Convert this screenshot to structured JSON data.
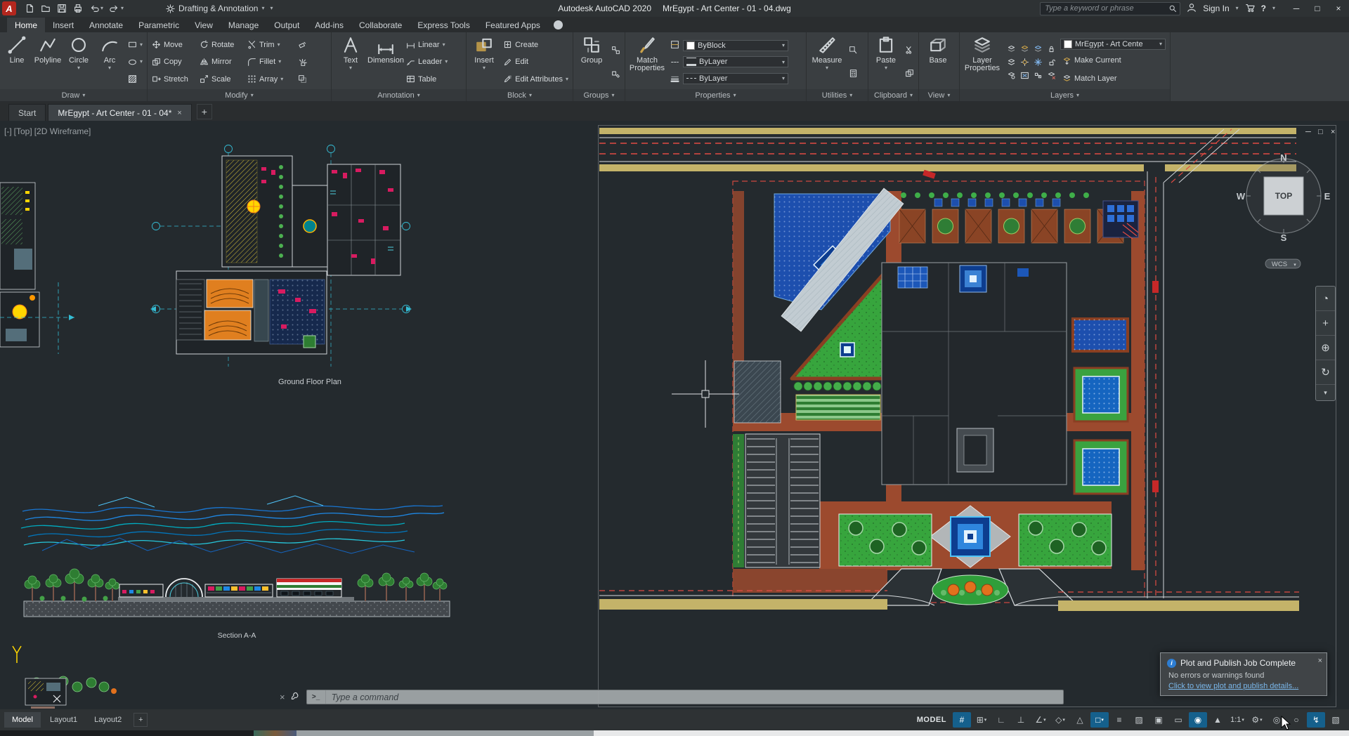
{
  "icons": {
    "caret": "▾",
    "minimize": "─",
    "maximize": "□",
    "close": "×",
    "plus": "+",
    "prompt": ">_",
    "help": "?",
    "info": "i"
  },
  "titlebar": {
    "workspace": "Drafting & Annotation",
    "app_title": "Autodesk AutoCAD 2020",
    "doc_title": "MrEgypt - Art Center - 01 - 04.dwg",
    "search_placeholder": "Type a keyword or phrase",
    "sign_in": "Sign In"
  },
  "ribbon": {
    "tabs": [
      "Home",
      "Insert",
      "Annotate",
      "Parametric",
      "View",
      "Manage",
      "Output",
      "Add-ins",
      "Collaborate",
      "Express Tools",
      "Featured Apps"
    ],
    "active_tab": "Home",
    "panels": {
      "draw": {
        "label": "Draw",
        "tools": {
          "line": "Line",
          "polyline": "Polyline",
          "circle": "Circle",
          "arc": "Arc"
        }
      },
      "modify": {
        "label": "Modify",
        "tools": {
          "move": "Move",
          "copy": "Copy",
          "stretch": "Stretch",
          "rotate": "Rotate",
          "mirror": "Mirror",
          "scale": "Scale",
          "trim": "Trim",
          "fillet": "Fillet",
          "array": "Array"
        }
      },
      "annotation": {
        "label": "Annotation",
        "tools": {
          "text": "Text",
          "dimension": "Dimension",
          "linear": "Linear",
          "leader": "Leader",
          "table": "Table"
        }
      },
      "block": {
        "label": "Block",
        "tools": {
          "insert": "Insert",
          "create": "Create",
          "edit": "Edit",
          "edit_attributes": "Edit Attributes"
        }
      },
      "groups": {
        "label": "Groups",
        "tools": {
          "group": "Group"
        }
      },
      "properties": {
        "label": "Properties",
        "tools": {
          "match": "Match Properties"
        },
        "combos": {
          "color": "ByBlock",
          "lineweight": "ByLayer",
          "linetype": "ByLayer"
        }
      },
      "utilities": {
        "label": "Utilities",
        "tools": {
          "measure": "Measure"
        }
      },
      "clipboard": {
        "label": "Clipboard",
        "tools": {
          "paste": "Paste"
        }
      },
      "view": {
        "label": "View",
        "tools": {
          "base": "Base"
        }
      },
      "layers": {
        "label": "Layers",
        "tools": {
          "layer_properties": "Layer Properties",
          "make_current": "Make Current",
          "match_layer": "Match Layer"
        },
        "current_layer": "MrEgypt - Art Cente"
      }
    }
  },
  "file_tabs": {
    "start": "Start",
    "document": "MrEgypt - Art Center - 01 - 04*"
  },
  "viewport": {
    "controls": [
      "[-]",
      "[Top]",
      "[2D Wireframe]"
    ]
  },
  "canvas": {
    "ground_floor_label": "Ground Floor Plan",
    "section_label": "Section A-A"
  },
  "viewcube": {
    "north": "N",
    "south": "S",
    "east": "E",
    "west": "W",
    "top": "TOP",
    "wcs": "WCS"
  },
  "navbar": {
    "items": [
      {
        "name": "full-navigation-wheel",
        "glyph": "◔"
      },
      {
        "name": "pan",
        "glyph": "+"
      },
      {
        "name": "zoom",
        "glyph": "⊕"
      },
      {
        "name": "orbit",
        "glyph": "↻"
      },
      {
        "name": "more",
        "glyph": "▾"
      }
    ]
  },
  "command": {
    "placeholder": "Type a command"
  },
  "layout_tabs": [
    "Model",
    "Layout1",
    "Layout2"
  ],
  "status": {
    "model": "MODEL",
    "scale": "1:1",
    "icons": [
      {
        "name": "grid-display",
        "glyph": "#",
        "active": true
      },
      {
        "name": "snap-mode",
        "glyph": "⊞"
      },
      {
        "name": "infer-constraints",
        "glyph": "∟"
      },
      {
        "name": "ortho-mode",
        "glyph": "⊥"
      },
      {
        "name": "polar-tracking",
        "glyph": "∠"
      },
      {
        "name": "isometric-drafting",
        "glyph": "◇"
      },
      {
        "name": "object-snap-tracking",
        "glyph": "△"
      },
      {
        "name": "object-snap",
        "glyph": "□",
        "active": true
      },
      {
        "name": "lineweight",
        "glyph": "≡"
      },
      {
        "name": "transparency",
        "glyph": "▨"
      },
      {
        "name": "selection-cycling",
        "glyph": "▣"
      },
      {
        "name": "dynamic-input",
        "glyph": "▭"
      },
      {
        "name": "annotation-visibility",
        "glyph": "◉",
        "active": true
      },
      {
        "name": "autoscale",
        "glyph": "▲"
      },
      {
        "name": "workspace-switching",
        "glyph": "⚙"
      },
      {
        "name": "annotation-monitor",
        "glyph": "◎"
      },
      {
        "name": "isolate-objects",
        "glyph": "○"
      },
      {
        "name": "graphics-performance",
        "glyph": "↯",
        "active": true
      },
      {
        "name": "clean-screen",
        "glyph": "▧"
      }
    ]
  },
  "notification": {
    "title": "Plot and Publish Job Complete",
    "body": "No errors or warnings found",
    "link": "Click to view plot and publish details..."
  },
  "colors": {
    "brand_red": "#b3271e",
    "active_toggle": "#15608c",
    "link_blue": "#7ab7ea",
    "canvas_bg": "#242a2e",
    "road_khaki": "#c4b369",
    "site_green": "#37a53d",
    "site_brown": "#9c4a2e",
    "water_blue": "#1d4fae",
    "redline": "#e04b43"
  }
}
